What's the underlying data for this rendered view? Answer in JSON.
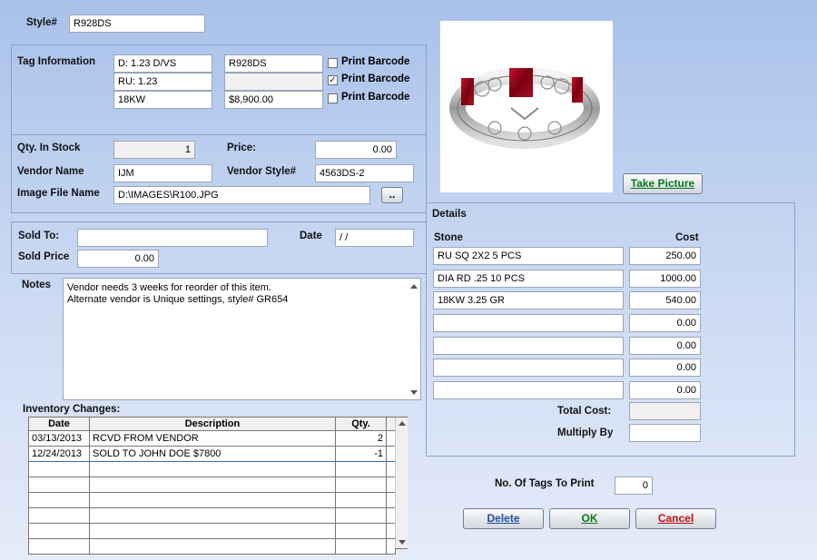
{
  "style": {
    "label": "Style#",
    "value": "R928DS"
  },
  "tag_info": {
    "label": "Tag Information",
    "lines": [
      {
        "left": "D: 1.23 D/VS",
        "right": "R928DS",
        "print_label": "Print Barcode",
        "checked": false
      },
      {
        "left": "RU: 1.23",
        "right": "",
        "print_label": "Print Barcode",
        "checked": true
      },
      {
        "left": "18KW",
        "right": "$8,900.00",
        "print_label": "Print Barcode",
        "checked": false
      }
    ]
  },
  "stock": {
    "qty_label": "Qty. In Stock",
    "qty_value": "1",
    "price_label": "Price:",
    "price_value": "0.00",
    "vendor_label": "Vendor Name",
    "vendor_value": "IJM",
    "vendor_style_label": "Vendor Style#",
    "vendor_style_value": "4563DS-2",
    "image_label": "Image File Name",
    "image_value": "D:\\IMAGES\\R100.JPG",
    "browse_label": ".."
  },
  "sold": {
    "sold_to_label": "Sold To:",
    "sold_to_value": "",
    "date_label": "Date",
    "date_value": " / /",
    "sold_price_label": "Sold Price",
    "sold_price_value": "0.00"
  },
  "notes": {
    "label": "Notes",
    "lines": [
      "Vendor needs 3 weeks for reorder of this item.",
      "Alternate vendor is Unique settings, style# GR654"
    ]
  },
  "inventory": {
    "label": "Inventory Changes:",
    "headers": [
      "Date",
      "Description",
      "Qty."
    ],
    "rows": [
      {
        "date": "03/13/2013",
        "desc": "RCVD FROM VENDOR",
        "qty": "2"
      },
      {
        "date": "12/24/2013",
        "desc": "SOLD TO JOHN DOE $7800",
        "qty": "-1"
      },
      {
        "date": "",
        "desc": "",
        "qty": ""
      },
      {
        "date": "",
        "desc": "",
        "qty": ""
      },
      {
        "date": "",
        "desc": "",
        "qty": ""
      },
      {
        "date": "",
        "desc": "",
        "qty": ""
      },
      {
        "date": "",
        "desc": "",
        "qty": ""
      },
      {
        "date": "",
        "desc": "",
        "qty": ""
      }
    ]
  },
  "picture": {
    "take_picture_label": "Take Picture"
  },
  "details": {
    "label": "Details",
    "stone_header": "Stone",
    "cost_header": "Cost",
    "rows": [
      {
        "stone": "RU SQ 2X2   5 PCS",
        "cost": "250.00"
      },
      {
        "stone": "DIA RD .25 10 PCS",
        "cost": "1000.00"
      },
      {
        "stone": "18KW 3.25 GR",
        "cost": "540.00"
      },
      {
        "stone": "",
        "cost": "0.00"
      },
      {
        "stone": "",
        "cost": "0.00"
      },
      {
        "stone": "",
        "cost": "0.00"
      },
      {
        "stone": "",
        "cost": "0.00"
      }
    ],
    "total_cost_label": "Total Cost:",
    "total_cost_value": "",
    "multiply_label": "Multiply By",
    "multiply_value": ""
  },
  "tags": {
    "label": "No. Of Tags To Print",
    "value": "0"
  },
  "buttons": {
    "delete": "Delete",
    "ok": "OK",
    "cancel": "Cancel"
  },
  "colors": {
    "ok_text": "#0a7a1a",
    "cancel_text": "#c01010",
    "delete_text": "#1e50a0"
  }
}
